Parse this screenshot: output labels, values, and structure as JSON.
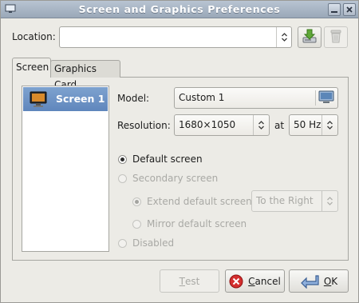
{
  "window": {
    "title": "Screen and Graphics Preferences",
    "accent_color": "#6589bf"
  },
  "titlebar_buttons": {
    "minimize_icon": "minimize-icon",
    "close_icon": "close-icon"
  },
  "location": {
    "label": "Location:",
    "value": "",
    "save_icon": "save-download-icon",
    "delete_icon": "trash-icon"
  },
  "tabs": [
    {
      "label": "Screen",
      "active": true
    },
    {
      "label": "Graphics Card",
      "active": false
    }
  ],
  "screen_list": {
    "items": [
      {
        "label": "Screen 1",
        "selected": true
      }
    ]
  },
  "form": {
    "model_label": "Model:",
    "model_value": "Custom 1",
    "resolution_label": "Resolution:",
    "resolution_value": "1680×1050",
    "at_label": "at",
    "refresh_value": "50 Hz",
    "options": {
      "default_screen": "Default screen",
      "secondary_screen": "Secondary screen",
      "extend_default": "Extend default screen:",
      "extend_position": "To the Right",
      "mirror_default": "Mirror default screen",
      "disabled": "Disabled"
    }
  },
  "buttons": {
    "test_first": "T",
    "test_rest": "est",
    "cancel_first": "C",
    "cancel_rest": "ancel",
    "ok_first": "O",
    "ok_rest": "K"
  }
}
